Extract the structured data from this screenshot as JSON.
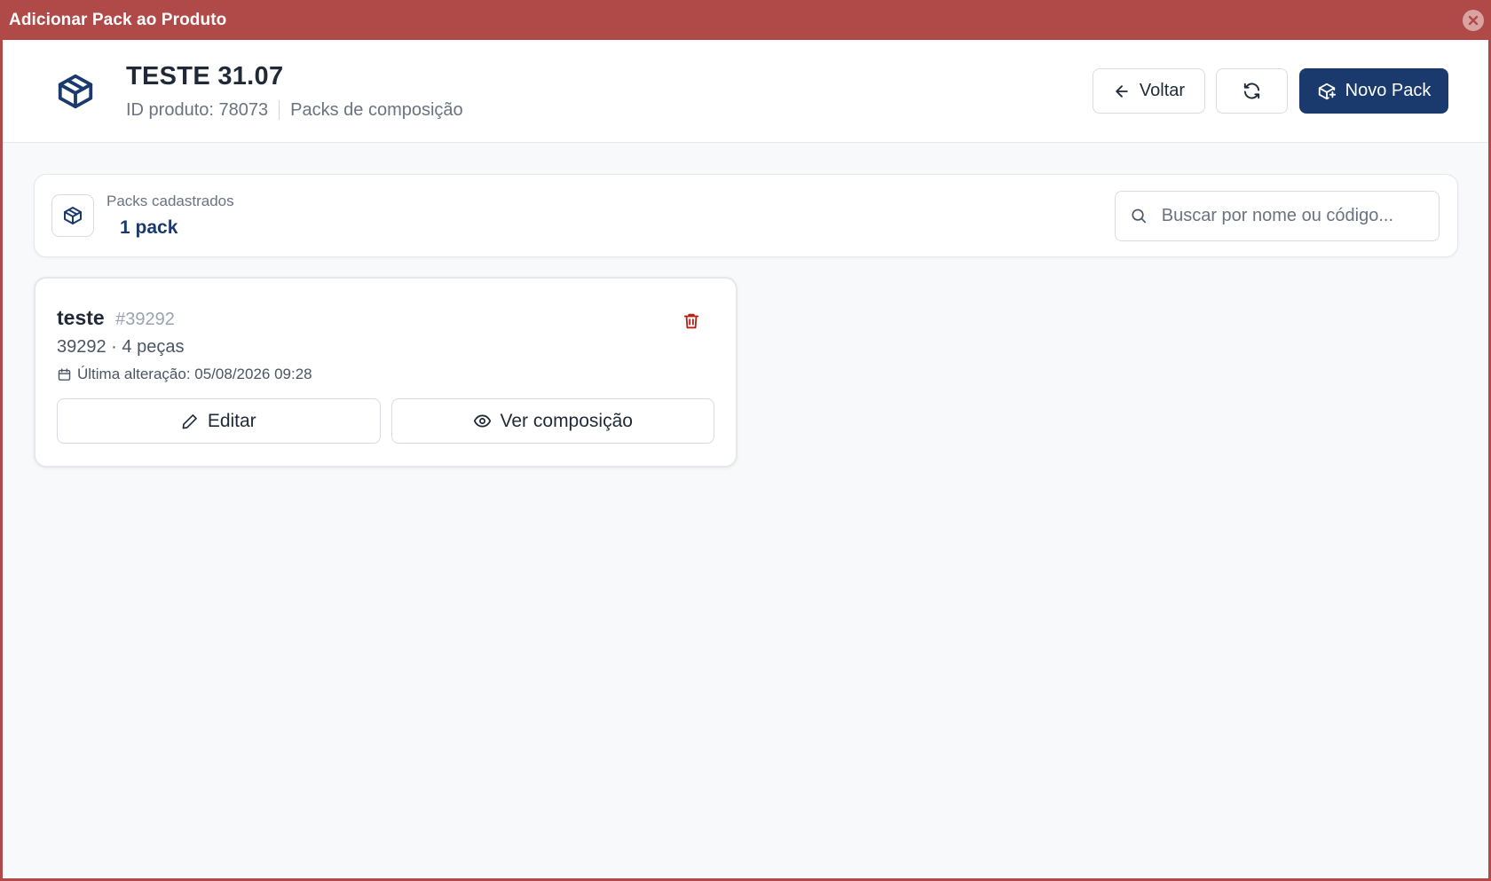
{
  "window": {
    "title": "Adicionar Pack ao Produto"
  },
  "header": {
    "product_name": "TESTE 31.07",
    "product_id": "ID produto: 78073",
    "section": "Packs de composição",
    "back_label": "Voltar",
    "new_pack_label": "Novo Pack"
  },
  "summary": {
    "label": "Packs cadastrados",
    "count": "1 pack",
    "search_placeholder": "Buscar por nome ou código..."
  },
  "packs": [
    {
      "name": "teste",
      "code": "#39292",
      "meta": "39292 · 4 peças",
      "last_modified": "Última alteração: 05/08/2026 09:28",
      "edit_label": "Editar",
      "view_label": "Ver composição"
    }
  ],
  "colors": {
    "titlebar": "#af4a48",
    "primary": "#1a3a6e",
    "danger": "#b42318"
  },
  "icons": [
    "close-icon",
    "box-icon",
    "arrow-left-icon",
    "refresh-icon",
    "package-plus-icon",
    "search-icon",
    "trash-icon",
    "calendar-icon",
    "pencil-icon",
    "eye-icon"
  ]
}
